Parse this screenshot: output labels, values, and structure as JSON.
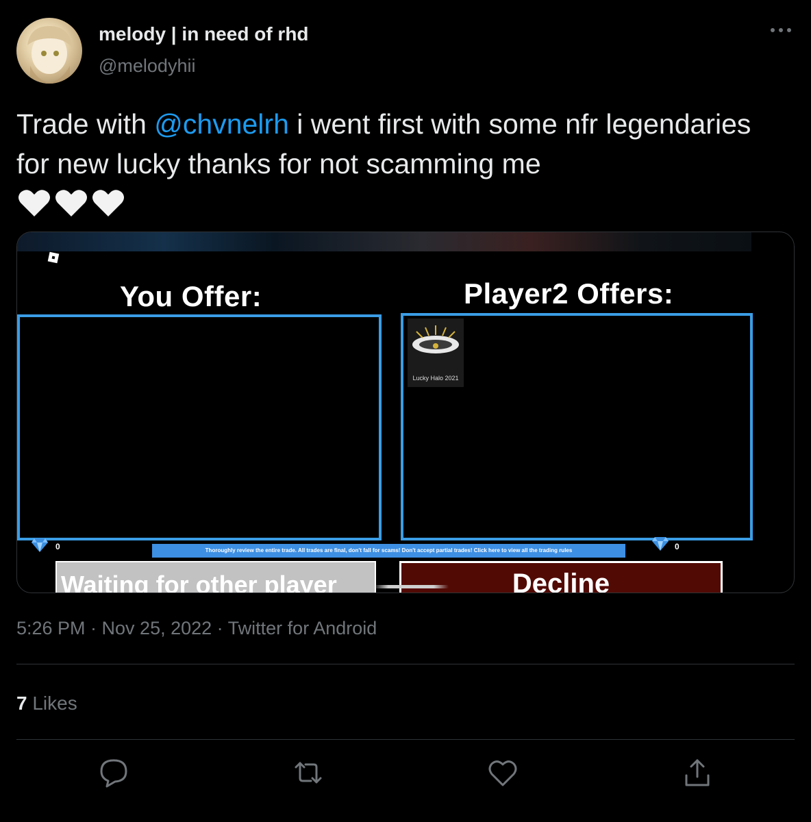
{
  "tweet": {
    "display_name": "melody | in need of rhd",
    "handle": "@melodyhii",
    "text_prefix": "Trade with ",
    "mention": "@chvnelrh",
    "text_suffix": " i went first with some nfr legendaries for new lucky thanks for not scamming me",
    "hearts": "🤍🤍🤍",
    "meta": "5:26 PM · Nov 25, 2022 · Twitter for Android",
    "likes_count": "7",
    "likes_label": " Likes"
  },
  "trade": {
    "you_offer_title": "You Offer:",
    "player_offer_title": "Player2 Offers:",
    "item_label": "Lucky Halo 2021",
    "left_gems": "0",
    "right_gems": "0",
    "rules_text": "Thoroughly review the entire trade. All trades are final, don't fall for scams! Don't accept partial trades! Click here to view all the trading rules",
    "waiting_label": "Waiting for other player",
    "decline_label": "Decline"
  },
  "icons": {
    "more": "more-icon",
    "reply": "reply-icon",
    "retweet": "retweet-icon",
    "like": "like-icon",
    "share": "share-icon",
    "gem": "diamond-gem-icon",
    "roblox": "roblox-logo-icon"
  },
  "colors": {
    "mention": "#1d9bf0",
    "offer_border": "#3b9de6",
    "decline_bg": "#520a05",
    "waiting_bg": "#c2c2c2"
  }
}
